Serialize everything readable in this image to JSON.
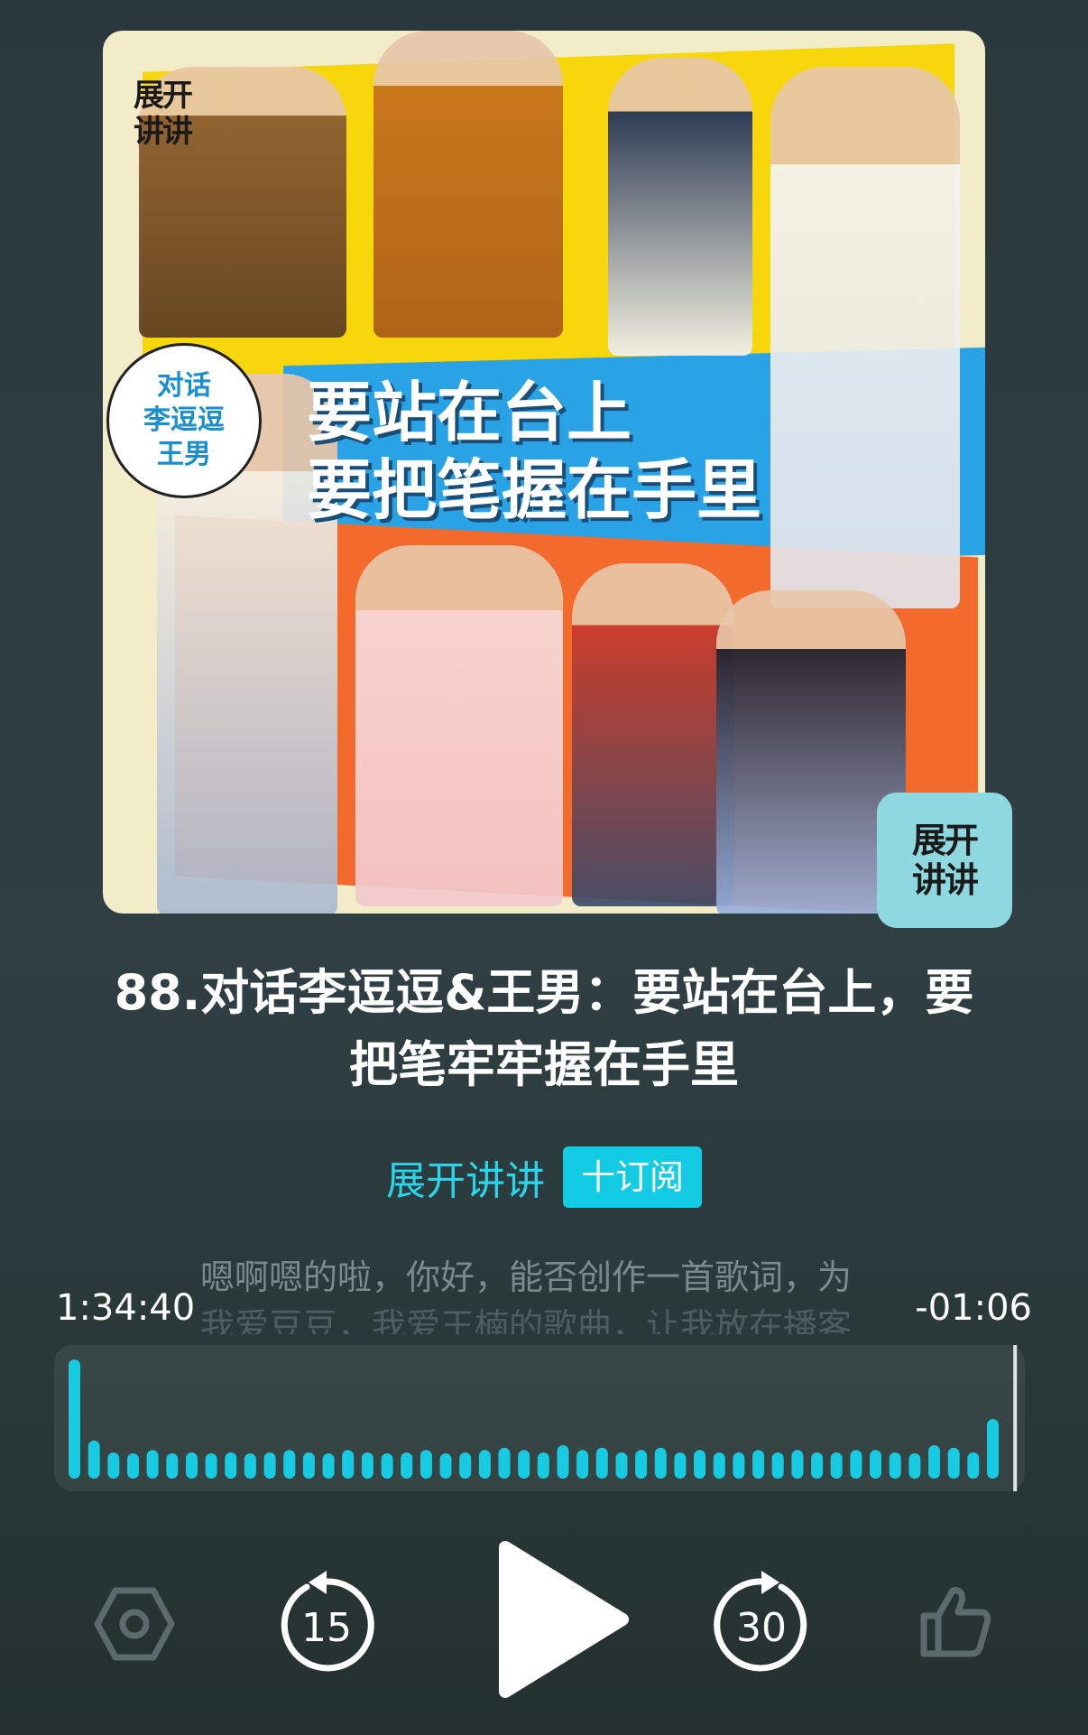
{
  "cover": {
    "logo_text": "展开讲讲",
    "badge_lines": [
      "对话",
      "李逗逗",
      "王男"
    ],
    "banner_lines": [
      "要站在台上",
      "要把笔握在手里"
    ],
    "corner_logo_lines": [
      "展开",
      "讲讲"
    ]
  },
  "episode": {
    "title_line1": "88.对话李逗逗&王男：要站在台上，要",
    "title_line2": "把笔牢牢握在手里"
  },
  "podcast": {
    "name": "展开讲讲",
    "subscribe_label": "十订阅"
  },
  "transcript": {
    "line1": "嗯啊嗯的啦，你好，能否创作一首歌词，为",
    "line2": "我爱豆豆，我爱王楠的歌曲，让我放在播客"
  },
  "player": {
    "elapsed": "1:34:40",
    "remaining": "-01:06",
    "progress": 0.99,
    "skip_back_seconds": "15",
    "skip_forward_seconds": "30",
    "accent_color": "#17cbe3"
  },
  "controls": {
    "settings_icon": "hexagon-settings-icon",
    "play_icon": "play-icon",
    "like_icon": "thumbs-up-icon"
  }
}
